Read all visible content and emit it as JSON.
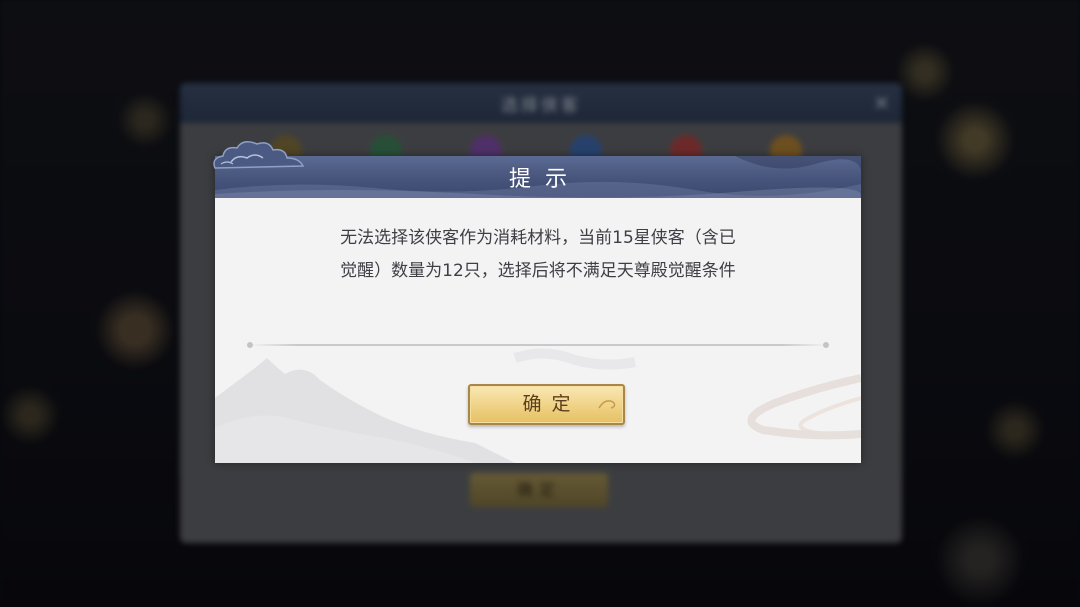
{
  "background": {
    "panel_title": "选择侠客",
    "panel_button_label": "确定",
    "avatar_colors": [
      "#7b6a3a",
      "#3c7a56",
      "#7a4aa0",
      "#3c64a8",
      "#a84040",
      "#a87a30"
    ]
  },
  "dialog": {
    "title": "提示",
    "message": "无法选择该侠客作为消耗材料，当前15星侠客（含已觉醒）数量为12只，选择后将不满足天尊殿觉醒条件",
    "confirm_label": "确定"
  },
  "colors": {
    "header": "#45527a",
    "button_gold": "#f1d68d",
    "text": "#3e3e44"
  }
}
